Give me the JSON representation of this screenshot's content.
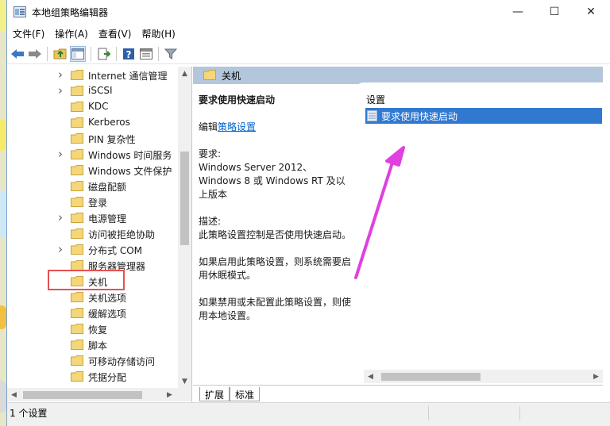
{
  "window": {
    "title": "本地组策略编辑器",
    "minimize_glyph": "—",
    "maximize_glyph": "☐",
    "close_glyph": "✕"
  },
  "menu": [
    "文件(F)",
    "操作(A)",
    "查看(V)",
    "帮助(H)"
  ],
  "toolbar_icons": [
    "back-arrow-icon",
    "forward-arrow-icon",
    "up-folder-icon",
    "show-hide-tree-icon",
    "export-list-icon",
    "help-icon",
    "properties-icon",
    "filter-icon"
  ],
  "tree": {
    "items": [
      {
        "label": "Internet 通信管理",
        "expandable": true
      },
      {
        "label": "iSCSI",
        "expandable": true
      },
      {
        "label": "KDC",
        "expandable": false
      },
      {
        "label": "Kerberos",
        "expandable": false
      },
      {
        "label": "PIN 复杂性",
        "expandable": false
      },
      {
        "label": "Windows 时间服务",
        "expandable": true
      },
      {
        "label": "Windows 文件保护",
        "expandable": false
      },
      {
        "label": "磁盘配额",
        "expandable": false
      },
      {
        "label": "登录",
        "expandable": false
      },
      {
        "label": "电源管理",
        "expandable": true
      },
      {
        "label": "访问被拒绝协助",
        "expandable": false
      },
      {
        "label": "分布式 COM",
        "expandable": true
      },
      {
        "label": "服务器管理器",
        "expandable": false
      },
      {
        "label": "关机",
        "expandable": false,
        "highlighted": true
      },
      {
        "label": "关机选项",
        "expandable": false
      },
      {
        "label": "缓解选项",
        "expandable": false
      },
      {
        "label": "恢复",
        "expandable": false
      },
      {
        "label": "脚本",
        "expandable": false
      },
      {
        "label": "可移动存储访问",
        "expandable": false
      },
      {
        "label": "凭据分配",
        "expandable": false
      }
    ]
  },
  "details": {
    "header": "关机",
    "setting_title": "要求使用快速启动",
    "edit_prefix": "编辑",
    "edit_link": "策略设置",
    "requirements_label": "要求:",
    "requirements_text": "Windows Server 2012、Windows 8 或 Windows RT 及以上版本",
    "description_label": "描述:",
    "description_text": "此策略设置控制是否使用快速启动。",
    "enabled_text": "如果启用此策略设置，则系统需要启用休眠模式。",
    "disabled_text": "如果禁用或未配置此策略设置，则使用本地设置。"
  },
  "settings_list": {
    "column_header": "设置",
    "items": [
      "要求使用快速启动"
    ]
  },
  "tabs": [
    "扩展",
    "标准"
  ],
  "status": "1 个设置",
  "colors": {
    "selection": "#3078d0",
    "header_bar": "#b4c6db",
    "annotation_arrow": "#e040e0",
    "highlight_box": "#e45252",
    "folder": "#f5d77a"
  }
}
